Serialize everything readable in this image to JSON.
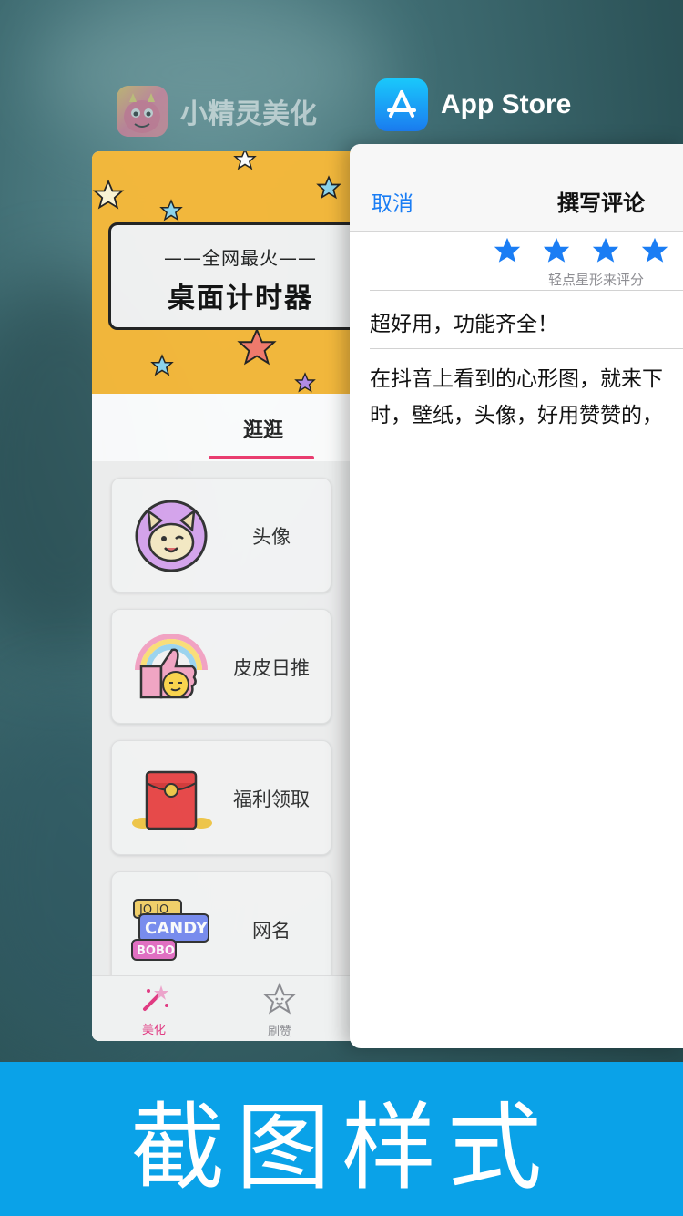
{
  "switcher": {
    "left_app": {
      "name": "小精灵美化",
      "icon": "monster-app-icon"
    },
    "right_app": {
      "name": "App Store",
      "icon": "appstore-icon"
    }
  },
  "left_card": {
    "banner": {
      "subtitle": "——全网最火——",
      "title": "桌面计时器"
    },
    "tab": {
      "label": "逛逛",
      "accent": "#ef3b6f"
    },
    "items": [
      {
        "label": "头像",
        "icon": "cat-avatar-icon"
      },
      {
        "label": "皮皮日推",
        "icon": "thumbs-up-rainbow-icon"
      },
      {
        "label": "福利领取",
        "icon": "red-envelope-icon"
      },
      {
        "label": "网名",
        "icon": "name-tags-icon"
      }
    ],
    "nav": [
      {
        "label": "美化",
        "icon": "magic-wand-icon",
        "active": true
      },
      {
        "label": "刷赞",
        "icon": "star-face-icon",
        "active": false
      }
    ]
  },
  "review": {
    "cancel": "取消",
    "title": "撰写评论",
    "rating": 4,
    "rating_hint": "轻点星形来评分",
    "headline": "超好用，功能齐全！",
    "body_line1": "在抖音上看到的心形图，就来下",
    "body_line2": "时，壁纸，头像，好用赞赞的，"
  },
  "footer": {
    "text": "截图样式"
  },
  "colors": {
    "footer_bg": "#0aa2e8",
    "ios_blue": "#1a7df4",
    "banner_yellow": "#f7b93a"
  }
}
